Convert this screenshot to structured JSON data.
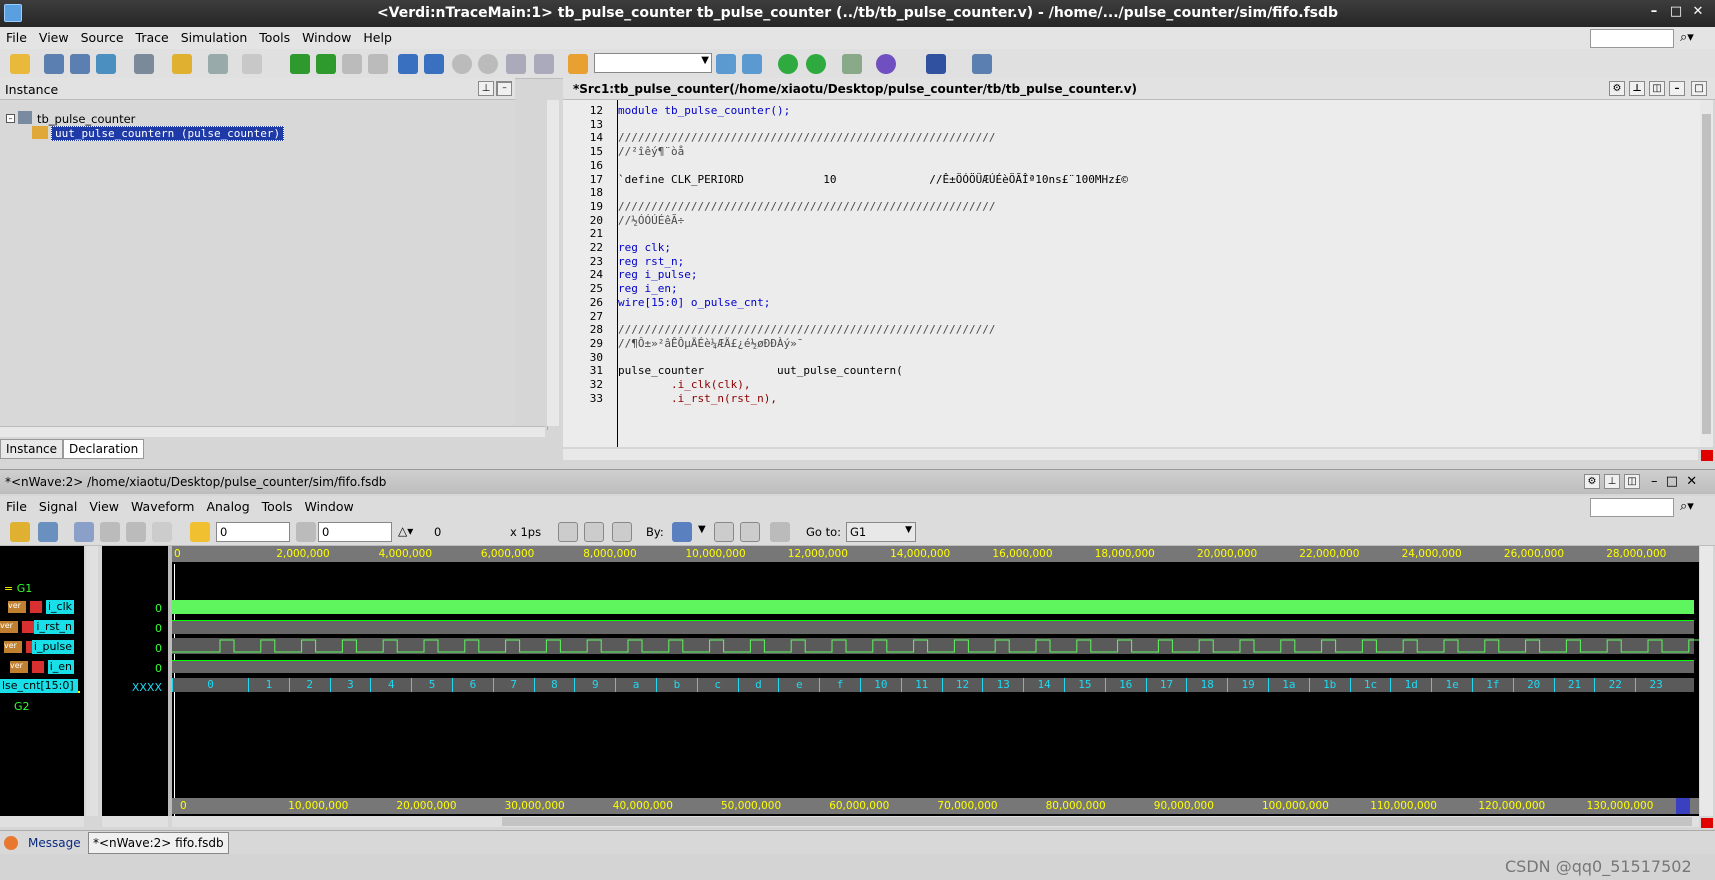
{
  "window": {
    "title": "<Verdi:nTraceMain:1> tb_pulse_counter tb_pulse_counter (../tb/tb_pulse_counter.v) - /home/.../pulse_counter/sim/fifo.fsdb"
  },
  "main_menu": [
    "File",
    "View",
    "Source",
    "Trace",
    "Simulation",
    "Tools",
    "Window",
    "Help"
  ],
  "instance_pane": {
    "title": "Instance",
    "tree": [
      {
        "label": "tb_pulse_counter"
      },
      {
        "label": "uut_pulse_countern (pulse_counter)"
      }
    ],
    "tabs": [
      "Instance",
      "Declaration"
    ]
  },
  "source_pane": {
    "title": "*Src1:tb_pulse_counter(/home/xiaotu/Desktop/pulse_counter/tb/tb_pulse_counter.v)",
    "lines": [
      {
        "n": "12",
        "t": "module tb_pulse_counter();"
      },
      {
        "n": "13",
        "t": ""
      },
      {
        "n": "14",
        "t": "/////////////////////////////////////////////////////////"
      },
      {
        "n": "15",
        "t": "//²îêý¶¨òå"
      },
      {
        "n": "16",
        "t": ""
      },
      {
        "n": "17",
        "t": "`define CLK_PERIORD            10              //Ê±ÖÓÖÜÆÚÉèÖÃÎª10ns£¨100MHz£©"
      },
      {
        "n": "18",
        "t": ""
      },
      {
        "n": "19",
        "t": "/////////////////////////////////////////////////////////"
      },
      {
        "n": "20",
        "t": "//½ÓÓÚÉêÃ÷"
      },
      {
        "n": "21",
        "t": ""
      },
      {
        "n": "22",
        "t": "reg clk;"
      },
      {
        "n": "23",
        "t": "reg rst_n;"
      },
      {
        "n": "24",
        "t": "reg i_pulse;"
      },
      {
        "n": "25",
        "t": "reg i_en;"
      },
      {
        "n": "26",
        "t": "wire[15:0] o_pulse_cnt;"
      },
      {
        "n": "27",
        "t": ""
      },
      {
        "n": "28",
        "t": "/////////////////////////////////////////////////////////"
      },
      {
        "n": "29",
        "t": "//¶Ô±»²âÊÔµÄÉè¼ÆÄ£¿é½øÐÐÀý»¯"
      },
      {
        "n": "30",
        "t": ""
      },
      {
        "n": "31",
        "t": "pulse_counter           uut_pulse_countern("
      },
      {
        "n": "32",
        "t": "        .i_clk(clk),"
      },
      {
        "n": "33",
        "t": "        .i_rst_n(rst_n),"
      }
    ]
  },
  "nwave": {
    "title": "*<nWave:2> /home/xiaotu/Desktop/pulse_counter/sim/fifo.fsdb",
    "menu": [
      "File",
      "Signal",
      "View",
      "Waveform",
      "Analog",
      "Tools",
      "Window"
    ],
    "cursor": "0",
    "marker": "0",
    "delta": "0",
    "unit": "x 1ps",
    "by_label": "By:",
    "goto_label": "Go to:",
    "goto_value": "G1",
    "groups": [
      "G1",
      "G2"
    ],
    "signals": [
      {
        "name": "i_clk",
        "value": "0"
      },
      {
        "name": "i_rst_n",
        "value": "0"
      },
      {
        "name": "i_pulse",
        "value": "0"
      },
      {
        "name": "i_en",
        "value": "0"
      },
      {
        "name": "lse_cnt[15:0]",
        "value": "XXXX"
      }
    ],
    "ruler_top": [
      "0",
      "2,000,000",
      "4,000,000",
      "6,000,000",
      "8,000,000",
      "10,000,000",
      "12,000,000",
      "14,000,000",
      "16,000,000",
      "18,000,000",
      "20,000,000",
      "22,000,000",
      "24,000,000",
      "26,000,000",
      "28,000,000"
    ],
    "ruler_bottom": [
      "0",
      "10,000,000",
      "20,000,000",
      "30,000,000",
      "40,000,000",
      "50,000,000",
      "60,000,000",
      "70,000,000",
      "80,000,000",
      "90,000,000",
      "100,000,000",
      "110,000,000",
      "120,000,000",
      "130,000,000"
    ],
    "bus_values": [
      "0",
      "1",
      "2",
      "3",
      "4",
      "5",
      "6",
      "7",
      "8",
      "9",
      "a",
      "b",
      "c",
      "d",
      "e",
      "f",
      "10",
      "11",
      "12",
      "13",
      "14",
      "15",
      "16",
      "17",
      "18",
      "19",
      "1a",
      "1b",
      "1c",
      "1d",
      "1e",
      "1f",
      "20",
      "21",
      "22",
      "23"
    ]
  },
  "bottom_tabs": [
    "Message",
    "*<nWave:2> fifo.fsdb"
  ],
  "watermark": "CSDN @qq0_51517502",
  "colors": {
    "signal_green": "#5ff55f",
    "bus_cyan": "#20d8f0",
    "ruler_yellow": "#ffff00",
    "wave_bg": "#000000"
  }
}
